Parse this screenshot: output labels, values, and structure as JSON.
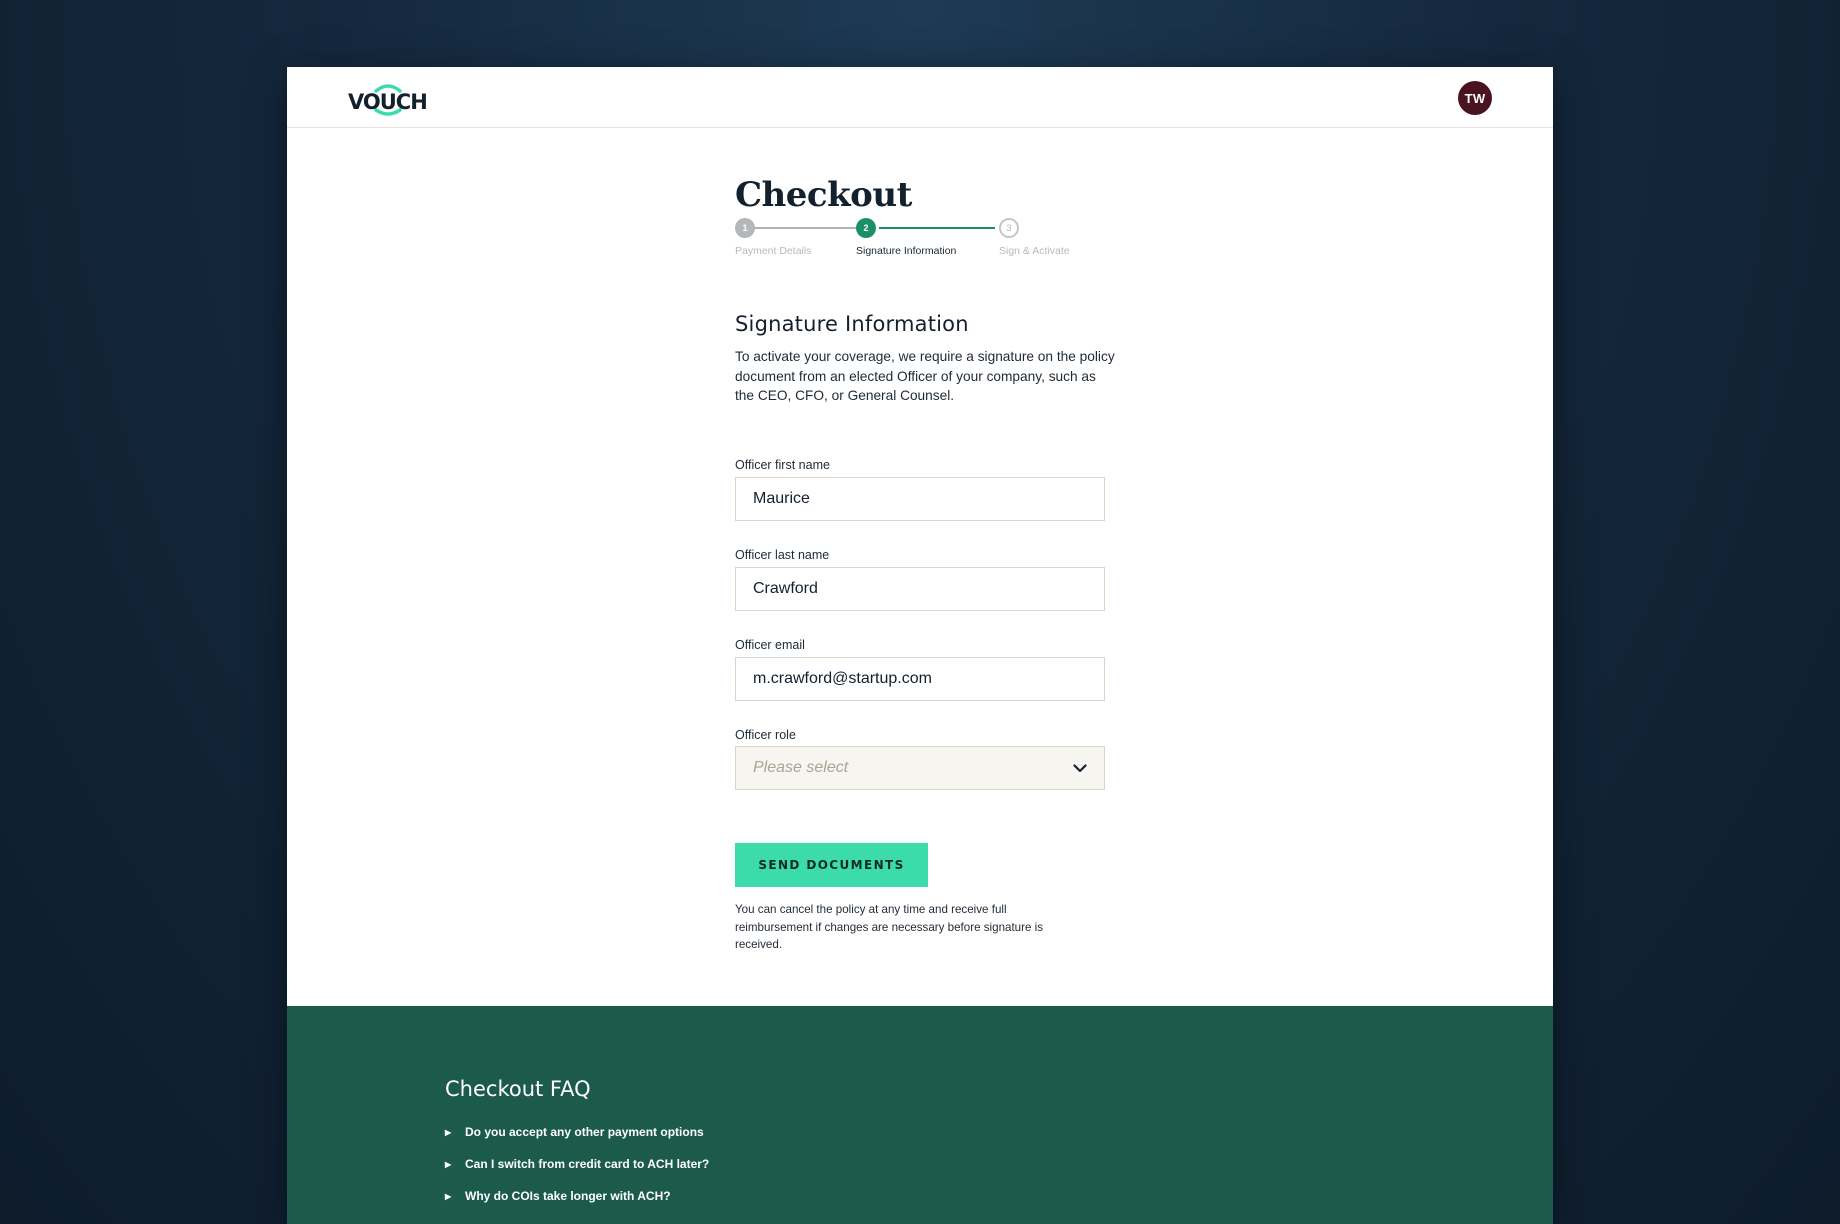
{
  "header": {
    "logo_text": "VOUCH",
    "avatar_initials": "TW"
  },
  "page": {
    "title": "Checkout"
  },
  "stepper": {
    "steps": [
      {
        "number": "1",
        "label": "Payment Details",
        "state": "completed"
      },
      {
        "number": "2",
        "label": "Signature Information",
        "state": "active"
      },
      {
        "number": "3",
        "label": "Sign & Activate",
        "state": "upcoming"
      }
    ]
  },
  "section": {
    "title": "Signature Information",
    "description": "To activate your coverage, we require a signature on the policy document from an elected Officer of your company, such as the CEO, CFO, or General Counsel."
  },
  "form": {
    "first_name": {
      "label": "Officer first name",
      "value": "Maurice"
    },
    "last_name": {
      "label": "Officer last name",
      "value": "Crawford"
    },
    "email": {
      "label": "Officer email",
      "value": "m.crawford@startup.com"
    },
    "role": {
      "label": "Officer role",
      "placeholder": "Please select"
    },
    "submit_label": "SEND DOCUMENTS",
    "note": "You can cancel the policy at any time and receive full reimbursement if changes are necessary before signature is received."
  },
  "faq": {
    "title": "Checkout FAQ",
    "items": [
      "Do you accept any other payment options",
      "Can I switch from credit card to ACH later?",
      "Why do COIs take longer with ACH?"
    ]
  },
  "colors": {
    "accent": "#3cdcaa",
    "step_active": "#1c8f6a",
    "faq_background": "#1c5b4b",
    "avatar_background": "#4a1322"
  }
}
